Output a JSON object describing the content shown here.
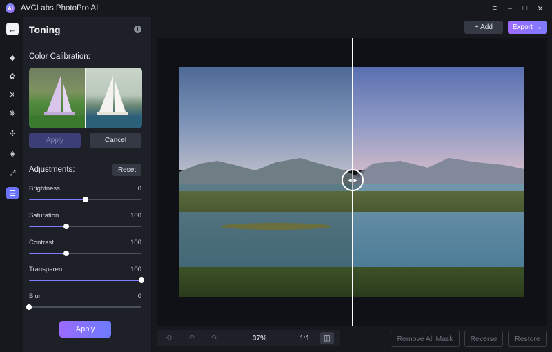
{
  "app": {
    "title": "AVCLabs PhotoPro AI",
    "logo_text": "AI"
  },
  "window_controls": [
    "≡",
    "–",
    "□",
    "✕"
  ],
  "rail": {
    "back": "←",
    "items": [
      {
        "name": "eraser-icon",
        "glyph": "◆"
      },
      {
        "name": "object-remove-icon",
        "glyph": "✿"
      },
      {
        "name": "enhance-icon",
        "glyph": "✕"
      },
      {
        "name": "background-icon",
        "glyph": "❋"
      },
      {
        "name": "replace-icon",
        "glyph": "✣"
      },
      {
        "name": "colorize-icon",
        "glyph": "◈"
      },
      {
        "name": "upscale-icon",
        "glyph": "⤢"
      },
      {
        "name": "toning-icon",
        "glyph": "☰"
      }
    ]
  },
  "panel": {
    "title": "Toning",
    "info": "i",
    "color_calibration_label": "Color Calibration:",
    "apply_disabled_label": "Apply",
    "cancel_label": "Cancel",
    "adjustments_label": "Adjustments:",
    "reset_label": "Reset",
    "sliders": [
      {
        "label": "Brightness",
        "value": "0",
        "fraction": 0.5
      },
      {
        "label": "Saturation",
        "value": "100",
        "fraction": 0.33
      },
      {
        "label": "Contrast",
        "value": "100",
        "fraction": 0.33
      },
      {
        "label": "Transparent",
        "value": "100",
        "fraction": 1.0
      },
      {
        "label": "Blur",
        "value": "0",
        "fraction": 0.0
      }
    ],
    "apply_label": "Apply"
  },
  "top_actions": {
    "add_label": "+ Add",
    "export_label": "Export",
    "export_arrow": "⌄"
  },
  "compare": {
    "handle_glyph": "◂ ▸"
  },
  "bottom_toolbar": {
    "reset_view": "⟲",
    "undo": "↶",
    "redo": "↷",
    "zoom_out": "−",
    "zoom_value": "37%",
    "zoom_in": "+",
    "actual_size": "1:1",
    "compare_toggle": "◫"
  },
  "mask_buttons": {
    "remove_all": "Remove All Mask",
    "reverse": "Reverse",
    "restore": "Restore"
  },
  "colors": {
    "accent": "#7f7cff",
    "export_gradient_start": "#9d6bff"
  }
}
